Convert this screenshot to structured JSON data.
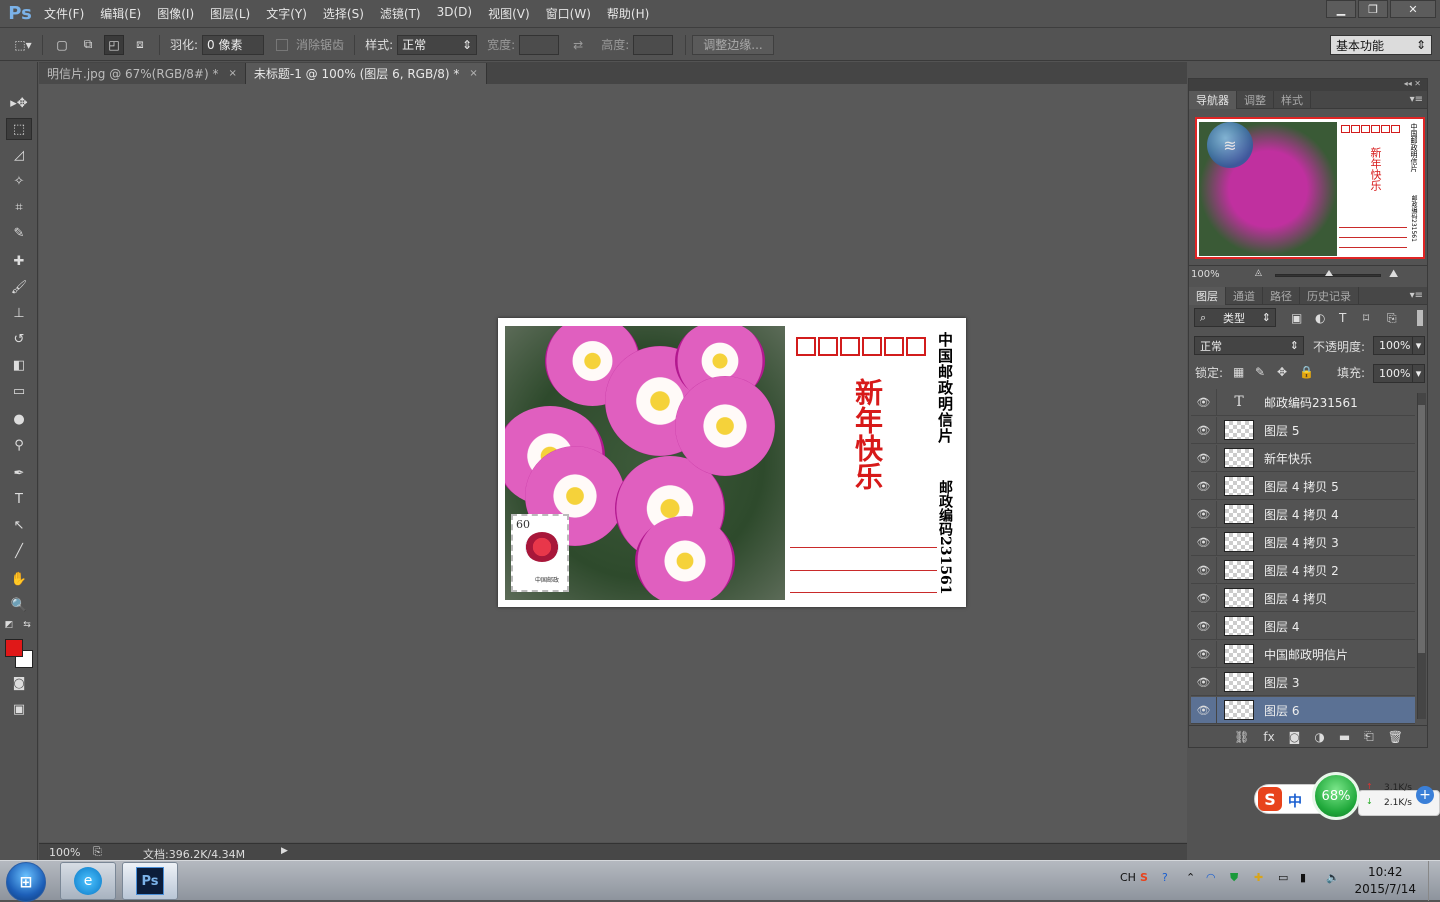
{
  "app": {
    "logo": "Ps"
  },
  "menu": [
    "文件(F)",
    "编辑(E)",
    "图像(I)",
    "图层(L)",
    "文字(Y)",
    "选择(S)",
    "滤镜(T)",
    "3D(D)",
    "视图(V)",
    "窗口(W)",
    "帮助(H)"
  ],
  "window_controls": {
    "minimize": "▁",
    "restore": "❐",
    "close": "✕"
  },
  "options": {
    "feather_label": "羽化:",
    "feather_value": "0 像素",
    "antialias_label": "消除锯齿",
    "style_label": "样式:",
    "style_value": "正常",
    "width_label": "宽度:",
    "height_label": "高度:",
    "refine_edge": "调整边缘...",
    "workspace": "基本功能"
  },
  "tabs": [
    {
      "label": "明信片.jpg @ 67%(RGB/8#) *",
      "close": "×"
    },
    {
      "label": "未标题-1 @ 100% (图层 6, RGB/8) *",
      "close": "×"
    }
  ],
  "postcard": {
    "title": "中国邮政明信片",
    "postal_code": "邮政编码231561",
    "seal": "新年快乐",
    "stamp_value": "60",
    "stamp_text": "中国邮政",
    "zip_box_count": 6
  },
  "navigator": {
    "tabs": [
      "导航器",
      "调整",
      "样式"
    ],
    "zoom": "100%"
  },
  "layers_panel": {
    "tabs": [
      "图层",
      "通道",
      "路径",
      "历史记录"
    ],
    "filter_label": "类型",
    "blend_mode": "正常",
    "opacity_label": "不透明度:",
    "opacity_value": "100%",
    "lock_label": "锁定:",
    "fill_label": "填充:",
    "fill_value": "100%",
    "layers": [
      {
        "name": "邮政编码231561",
        "type": "text"
      },
      {
        "name": "图层 5",
        "type": "pixel"
      },
      {
        "name": "新年快乐",
        "type": "pixel"
      },
      {
        "name": "图层 4 拷贝 5",
        "type": "pixel"
      },
      {
        "name": "图层 4 拷贝 4",
        "type": "pixel"
      },
      {
        "name": "图层 4 拷贝 3",
        "type": "pixel"
      },
      {
        "name": "图层 4 拷贝 2",
        "type": "pixel"
      },
      {
        "name": "图层 4 拷贝",
        "type": "pixel"
      },
      {
        "name": "图层 4",
        "type": "pixel"
      },
      {
        "name": "中国邮政明信片",
        "type": "pixel"
      },
      {
        "name": "图层 3",
        "type": "pixel"
      },
      {
        "name": "图层 6",
        "type": "pixel",
        "selected": true
      }
    ]
  },
  "status": {
    "zoom": "100%",
    "doc": "文档:396.2K/4.34M"
  },
  "ime": {
    "label": "中",
    "percent": "68%",
    "up": "3.1K/s",
    "down": "2.1K/s"
  },
  "taskbar": {
    "tray_lang": "CH",
    "time": "10:42",
    "date": "2015/7/14"
  },
  "colors": {
    "foreground": "#e01818",
    "background": "#ffffff",
    "accent_red": "#d21c1c",
    "selected_layer": "#5b7194"
  }
}
